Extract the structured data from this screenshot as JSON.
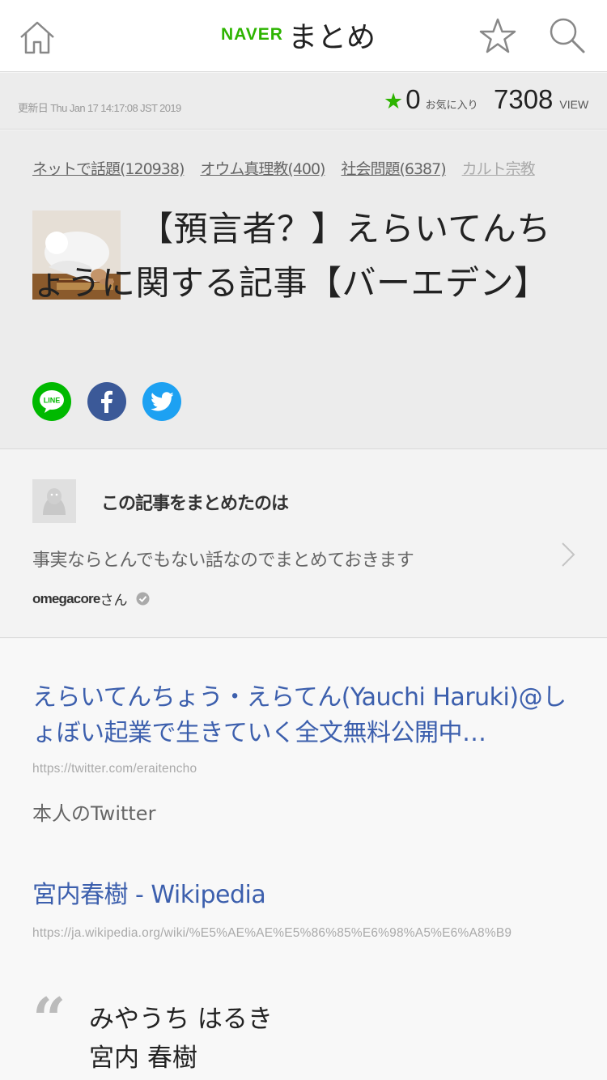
{
  "header": {
    "logo_brand": "NAVER",
    "logo_service": "まとめ"
  },
  "meta": {
    "updated": "更新日 Thu Jan 17 14:17:08 JST 2019",
    "favorites_count": "0",
    "favorites_label": "お気に入り",
    "view_count": "7308",
    "view_label": "VIEW"
  },
  "article": {
    "tags": [
      {
        "label": "ネットで話題(120938)"
      },
      {
        "label": "オウム真理教(400)"
      },
      {
        "label": "社会問題(6387)"
      },
      {
        "label": "カルト宗教"
      }
    ],
    "title": "【預言者？】えらいてんちょうに関する記事【バーエデン】",
    "share": {
      "line_label": "LINE"
    }
  },
  "curator": {
    "heading": "この記事をまとめたのは",
    "description": "事実ならとんでもない話なのでまとめておきます",
    "username": "omegacore",
    "suffix": "さん"
  },
  "content": {
    "links": [
      {
        "title": "えらいてんちょう・えらてん(Yauchi Haruki)@しょぼい起業で生きていく全文無料公開中…",
        "url": "https://twitter.com/eraitencho",
        "description": "本人のTwitter"
      },
      {
        "title": "宮内春樹 - Wikipedia",
        "url": "https://ja.wikipedia.org/wiki/%E5%AE%AE%E5%86%85%E6%98%A5%E6%A8%B9"
      }
    ],
    "quote": {
      "mark": "“",
      "line1": "みやうち はるき",
      "line2": "宮内 春樹"
    }
  },
  "colors": {
    "brand_green": "#2db400",
    "link_blue": "#3c5fad",
    "line_green": "#00b900",
    "facebook_blue": "#3b5998",
    "twitter_blue": "#1da1f2"
  }
}
